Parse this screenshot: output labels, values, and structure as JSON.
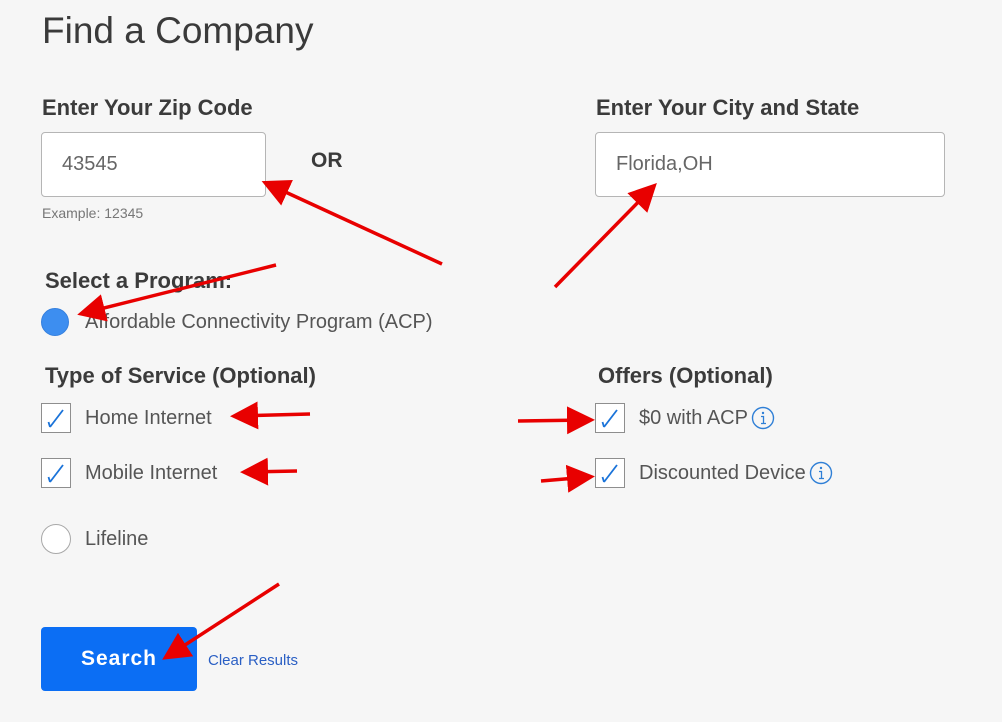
{
  "page": {
    "title": "Find a Company"
  },
  "zip": {
    "label": "Enter Your Zip Code",
    "value": "43545",
    "hint": "Example: 12345"
  },
  "or_label": "OR",
  "city": {
    "label": "Enter Your City and State",
    "value": "Florida,OH"
  },
  "program": {
    "label": "Select a Program:",
    "options": [
      {
        "label": "Affordable Connectivity Program (ACP)",
        "selected": true
      }
    ]
  },
  "service": {
    "label": "Type of Service (Optional)",
    "options": [
      {
        "label": "Home Internet",
        "checked": true
      },
      {
        "label": "Mobile Internet",
        "checked": true
      },
      {
        "label": "Lifeline",
        "selected": false
      }
    ]
  },
  "offers": {
    "label": "Offers (Optional)",
    "options": [
      {
        "label": "$0 with ACP",
        "checked": true,
        "info_icon": "info-icon"
      },
      {
        "label": "Discounted Device",
        "checked": true,
        "info_icon": "info-icon"
      }
    ]
  },
  "actions": {
    "search_label": "Search",
    "clear_label": "Clear Results"
  },
  "colors": {
    "primary": "#0b6ef4",
    "radio_selected": "#3d8ef0",
    "link": "#2a5fc4",
    "annotation": "#e80000"
  }
}
